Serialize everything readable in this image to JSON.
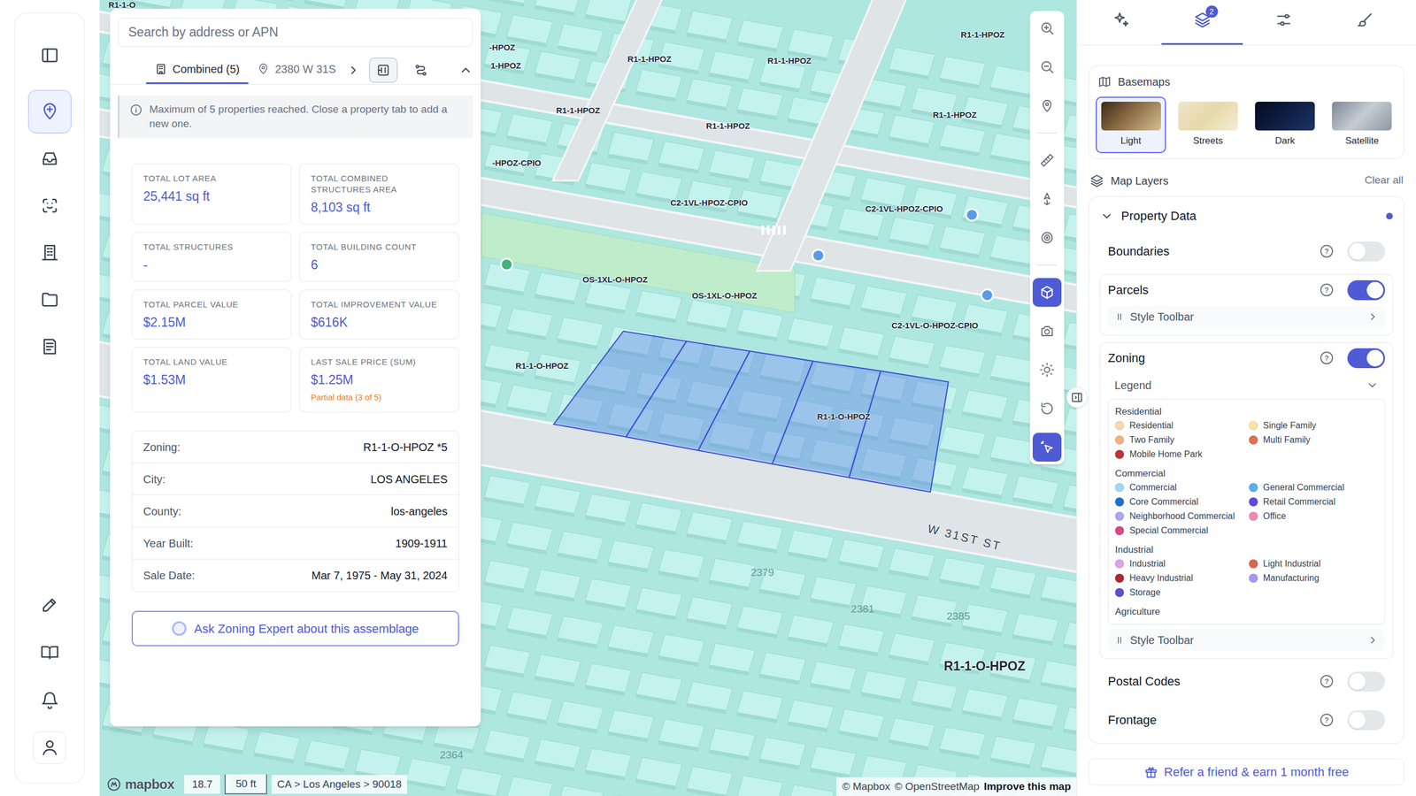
{
  "sidebar": {
    "items": [
      {
        "selected": false
      },
      {
        "selected": true
      },
      {
        "selected": false
      },
      {
        "selected": false
      },
      {
        "selected": false
      },
      {
        "selected": false
      },
      {
        "selected": false
      },
      {
        "selected": false
      },
      {
        "selected": false
      },
      {
        "selected": false
      },
      {
        "selected": false
      }
    ]
  },
  "search": {
    "placeholder": "Search by address or APN"
  },
  "property_tabs": [
    {
      "label": "Combined (5)",
      "selected": true
    },
    {
      "label": "2380 W 31S",
      "selected": false
    }
  ],
  "tab_tools": [
    {
      "selected": true
    },
    {
      "selected": false
    }
  ],
  "notice": "Maximum of 5 properties reached. Close a property tab to add a new one.",
  "stats": [
    {
      "label": "TOTAL LOT AREA",
      "value": "25,441 sq ft"
    },
    {
      "label": "TOTAL COMBINED STRUCTURES AREA",
      "value": "8,103 sq ft"
    },
    {
      "label": "TOTAL STRUCTURES",
      "value": "-"
    },
    {
      "label": "TOTAL BUILDING COUNT",
      "value": "6"
    },
    {
      "label": "TOTAL PARCEL VALUE",
      "value": "$2.15M"
    },
    {
      "label": "TOTAL IMPROVEMENT VALUE",
      "value": "$616K"
    },
    {
      "label": "TOTAL LAND VALUE",
      "value": "$1.53M"
    },
    {
      "label": "LAST SALE PRICE (SUM)",
      "value": "$1.25M",
      "note": "Partial data (3 of 5)"
    }
  ],
  "details": [
    {
      "label": "Zoning:",
      "value": "R1-1-O-HPOZ *5"
    },
    {
      "label": "City:",
      "value": "LOS ANGELES"
    },
    {
      "label": "County:",
      "value": "los-angeles"
    },
    {
      "label": "Year Built:",
      "value": "1909-1911"
    },
    {
      "label": "Sale Date:",
      "value": "Mar 7, 1975 - May 31, 2024"
    }
  ],
  "ask_button": "Ask Zoning Expert about this assemblage",
  "map": {
    "labels": [
      {
        "text": "R1-1-O",
        "kind": "zone"
      },
      {
        "text": "-HPOZ",
        "kind": "zone"
      },
      {
        "text": "1-HPOZ",
        "kind": "zone"
      },
      {
        "text": "R1-1-HPOZ",
        "kind": "zone"
      },
      {
        "text": "R1-1-HPOZ",
        "kind": "zone"
      },
      {
        "text": "R1-1-HPOZ",
        "kind": "zone"
      },
      {
        "text": "R1-1-HPOZ",
        "kind": "zone"
      },
      {
        "text": "R1-1-HPOZ",
        "kind": "zone"
      },
      {
        "text": "R1-1-HPOZ",
        "kind": "zone"
      },
      {
        "text": "-HPOZ-CPIO",
        "kind": "zone"
      },
      {
        "text": "C2-1VL-HPOZ-CPIO",
        "kind": "zone"
      },
      {
        "text": "C2-1VL-HPOZ-CPIO",
        "kind": "zone"
      },
      {
        "text": "OS-1XL-O-HPOZ",
        "kind": "zone"
      },
      {
        "text": "OS-1XL-O-HPOZ",
        "kind": "zone"
      },
      {
        "text": "C2-1VL-O-HPOZ-CPIO",
        "kind": "zone"
      },
      {
        "text": "R1-1-O-HPOZ",
        "kind": "zone"
      },
      {
        "text": "R1-1-O-HPOZ",
        "kind": "zone"
      },
      {
        "text": "R1-1-O-HPOZ",
        "kind": "large"
      },
      {
        "text": "W 31ST ST",
        "kind": "street"
      },
      {
        "text": "2379",
        "kind": "address"
      },
      {
        "text": "2381",
        "kind": "address"
      },
      {
        "text": "2385",
        "kind": "address"
      },
      {
        "text": "2364",
        "kind": "address"
      }
    ],
    "logo": "mapbox",
    "zoom": "18.7",
    "scale": "50 ft",
    "breadcrumb": "CA > Los Angeles > 90018",
    "attribution": {
      "mapbox": "© Mapbox",
      "osm": "© OpenStreetMap",
      "improve": "Improve this map"
    }
  },
  "map_tools": [
    {
      "selected": false
    },
    {
      "selected": false
    },
    {
      "selected": false
    },
    {
      "selected": false
    },
    {
      "selected": false
    },
    {
      "selected": false
    },
    {
      "selected": true
    },
    {
      "selected": false
    },
    {
      "selected": false
    },
    {
      "selected": false
    },
    {
      "selected": true
    }
  ],
  "right_tabs": [
    {
      "selected": false
    },
    {
      "selected": true,
      "badge": "2"
    },
    {
      "selected": false
    },
    {
      "selected": false
    }
  ],
  "basemaps": {
    "title": "Basemaps",
    "items": [
      {
        "label": "Light",
        "selected": true
      },
      {
        "label": "Streets",
        "selected": false
      },
      {
        "label": "Dark",
        "selected": false
      },
      {
        "label": "Satellite",
        "selected": false
      }
    ]
  },
  "layers": {
    "title": "Map Layers",
    "clear": "Clear all",
    "help": "?",
    "group": {
      "title": "Property Data",
      "expanded": true,
      "active": true,
      "items": [
        {
          "label": "Boundaries",
          "on": false,
          "kind": "plain"
        },
        {
          "label": "Parcels",
          "on": true,
          "kind": "styled",
          "style_label": "Style Toolbar"
        },
        {
          "label": "Zoning",
          "on": true,
          "kind": "legend",
          "style_label": "Style Toolbar",
          "legend": {
            "label": "Legend",
            "expanded": true,
            "groups": [
              {
                "title": "Residential",
                "items": [
                  {
                    "label": "Residential",
                    "color": "#f8d9a6"
                  },
                  {
                    "label": "Single Family",
                    "color": "#f9e4a0"
                  },
                  {
                    "label": "Two Family",
                    "color": "#f3b27a"
                  },
                  {
                    "label": "Multi Family",
                    "color": "#e0714e"
                  },
                  {
                    "label": "Mobile Home Park",
                    "color": "#c2313a"
                  }
                ]
              },
              {
                "title": "Commercial",
                "items": [
                  {
                    "label": "Commercial",
                    "color": "#9fd8f2"
                  },
                  {
                    "label": "General Commercial",
                    "color": "#5daef0"
                  },
                  {
                    "label": "Core Commercial",
                    "color": "#1f6fd6"
                  },
                  {
                    "label": "Retail Commercial",
                    "color": "#5b4be0"
                  },
                  {
                    "label": "Neighborhood Commercial",
                    "color": "#a9a9f3"
                  },
                  {
                    "label": "Office",
                    "color": "#f08bb0"
                  },
                  {
                    "label": "Special Commercial",
                    "color": "#d94787"
                  }
                ]
              },
              {
                "title": "Industrial",
                "items": [
                  {
                    "label": "Industrial",
                    "color": "#dca3e8"
                  },
                  {
                    "label": "Light Industrial",
                    "color": "#d6694a"
                  },
                  {
                    "label": "Heavy Industrial",
                    "color": "#b3252f"
                  },
                  {
                    "label": "Manufacturing",
                    "color": "#a499f0"
                  },
                  {
                    "label": "Storage",
                    "color": "#5c4fd6"
                  }
                ]
              },
              {
                "title": "Agriculture",
                "items": []
              }
            ]
          }
        },
        {
          "label": "Postal Codes",
          "on": false,
          "kind": "plain"
        },
        {
          "label": "Frontage",
          "on": false,
          "kind": "plain"
        }
      ]
    }
  },
  "referral": "Refer a friend & earn 1 month free"
}
